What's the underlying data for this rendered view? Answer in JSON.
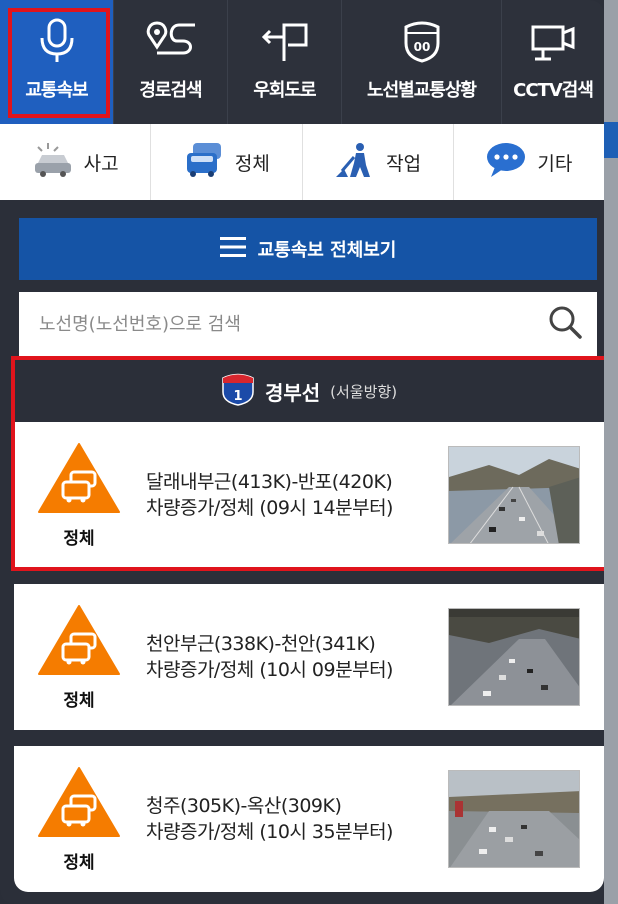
{
  "topnav": [
    {
      "label": "교통속보",
      "icon": "microphone-icon",
      "active": true
    },
    {
      "label": "경로검색",
      "icon": "route-icon",
      "active": false
    },
    {
      "label": "우회도로",
      "icon": "detour-arrow-icon",
      "active": false
    },
    {
      "label": "노선별교통상황",
      "icon": "highway-shield-icon",
      "active": false
    },
    {
      "label": "CCTV검색",
      "icon": "cctv-camera-icon",
      "active": false
    }
  ],
  "categories": [
    {
      "label": "사고",
      "icon": "accident-car-icon"
    },
    {
      "label": "정체",
      "icon": "congestion-cars-icon"
    },
    {
      "label": "작업",
      "icon": "roadwork-worker-icon"
    },
    {
      "label": "기타",
      "icon": "chat-bubble-icon"
    }
  ],
  "fullview": {
    "label": "교통속보 전체보기",
    "icon": "menu-icon"
  },
  "search": {
    "placeholder": "노선명(노선번호)으로 검색",
    "icon": "search-icon"
  },
  "route": {
    "number": "1",
    "name": "경부선",
    "direction": "(서울방향)"
  },
  "incidents": [
    {
      "type": "정체",
      "line1": "달래내부근(413K)-반포(420K)",
      "line2": "차량증가/정체 (09시 14분부터)"
    },
    {
      "type": "정체",
      "line1": "천안부근(338K)-천안(341K)",
      "line2": "차량증가/정체 (10시 09분부터)"
    },
    {
      "type": "정체",
      "line1": "청주(305K)-옥산(309K)",
      "line2": "차량증가/정체 (10시 35분부터)"
    }
  ],
  "colors": {
    "active_tab": "#1f5fbf",
    "fullview_bg": "#1554a6",
    "highlight": "#e0141c",
    "badge": "#f57c00"
  }
}
